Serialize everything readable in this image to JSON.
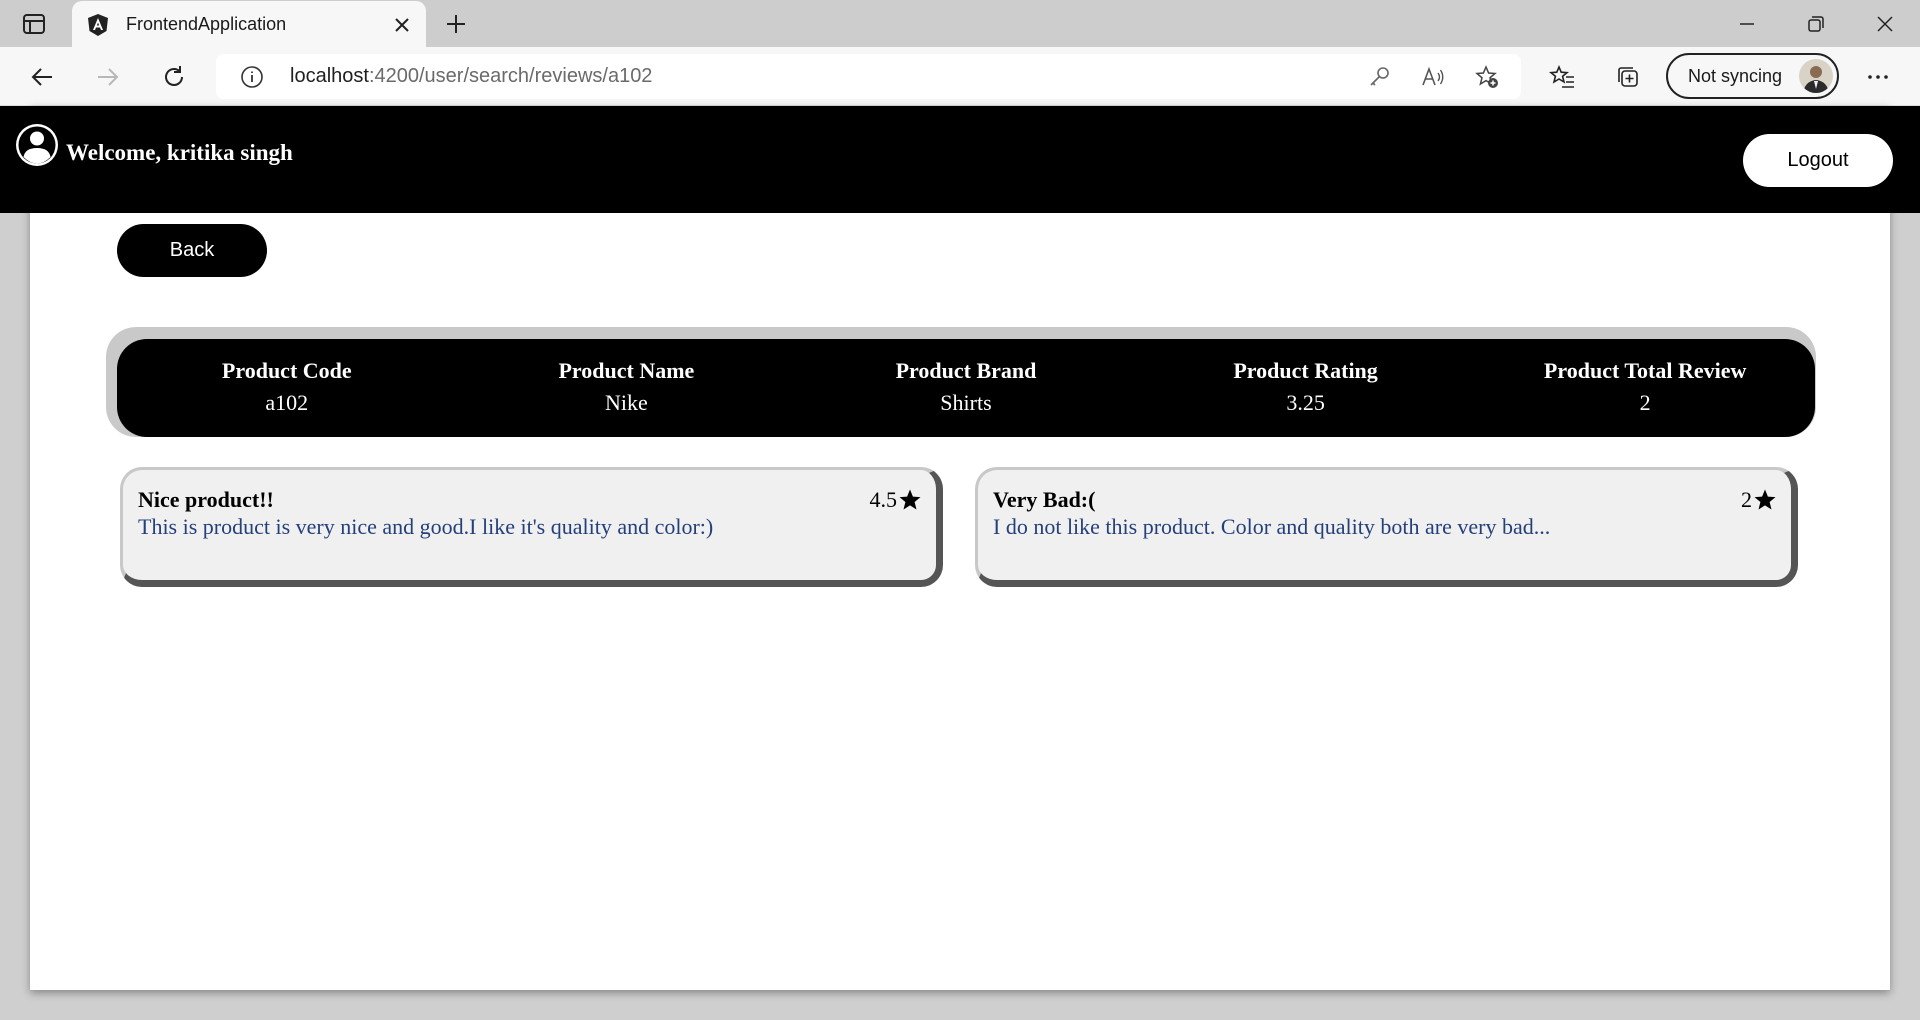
{
  "browser": {
    "tab_title": "FrontendApplication",
    "url_host": "localhost",
    "url_path": ":4200/user/search/reviews/a102",
    "sync_label": "Not syncing"
  },
  "header": {
    "welcome": "Welcome, kritika singh",
    "logout_label": "Logout"
  },
  "back_label": "Back",
  "product": {
    "code_label": "Product Code",
    "code": "a102",
    "name_label": "Product Name",
    "name": "Nike",
    "brand_label": "Product Brand",
    "brand": "Shirts",
    "rating_label": "Product Rating",
    "rating": "3.25",
    "reviews_label": "Product Total Review",
    "reviews": "2"
  },
  "reviews": [
    {
      "title": "Nice product!!",
      "text": "This is product is very nice and good.I like it's quality and color:)",
      "rating": "4.5"
    },
    {
      "title": "Very Bad:(",
      "text": "I do not like this product. Color and quality both are very bad...",
      "rating": "2"
    }
  ]
}
